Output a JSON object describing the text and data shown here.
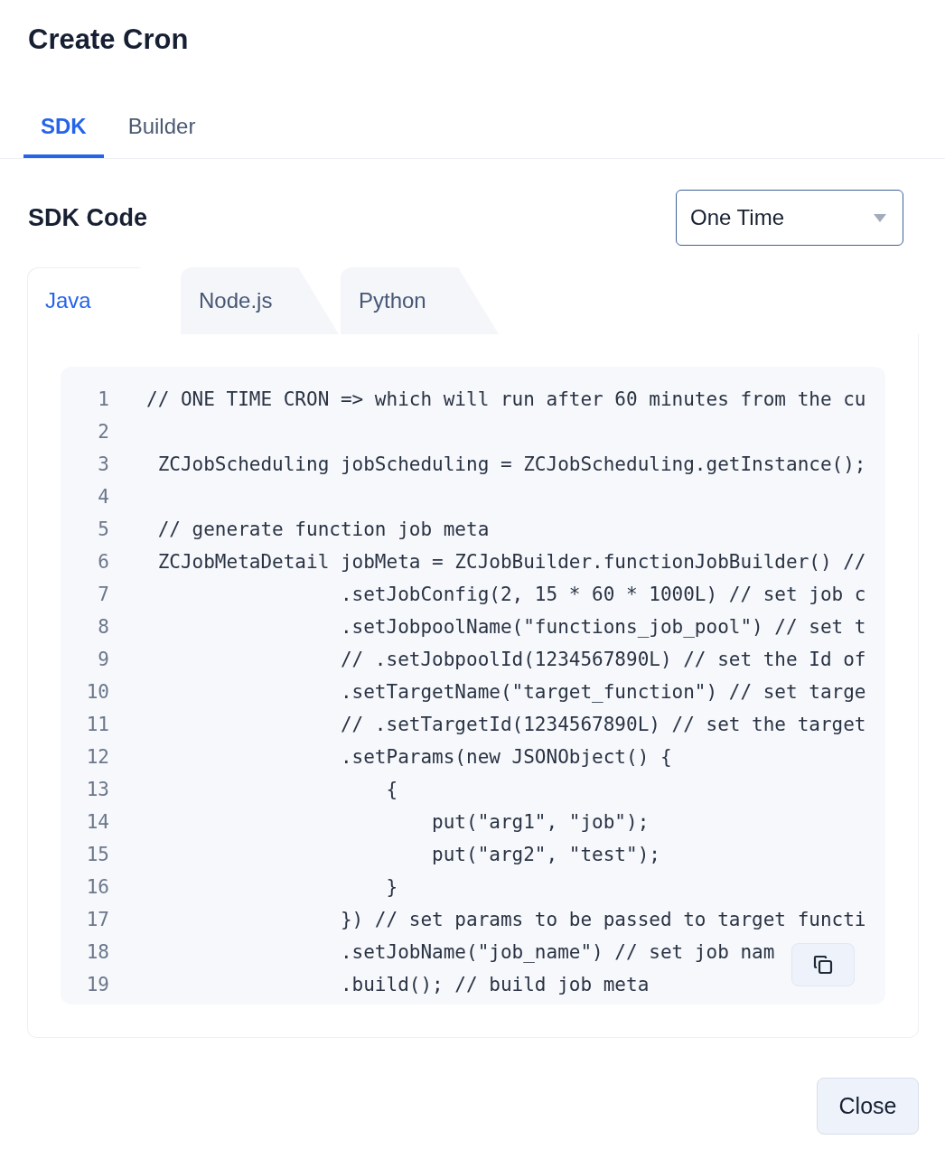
{
  "title": "Create Cron",
  "tabs": [
    {
      "label": "SDK",
      "selected": true
    },
    {
      "label": "Builder",
      "selected": false
    }
  ],
  "section_title": "SDK Code",
  "schedule_select": {
    "value": "One Time"
  },
  "language_tabs": [
    {
      "label": "Java",
      "selected": true
    },
    {
      "label": "Node.js",
      "selected": false
    },
    {
      "label": "Python",
      "selected": false
    }
  ],
  "code_lines": [
    {
      "number": "1",
      "text": "// ONE TIME CRON => which will run after 60 minutes from the cu"
    },
    {
      "number": "2"
    },
    {
      "number": "3",
      "text": " ZCJobScheduling jobScheduling = ZCJobScheduling.getInstance();"
    },
    {
      "number": "4"
    },
    {
      "number": "5",
      "text": " // generate function job meta"
    },
    {
      "number": "6",
      "text": " ZCJobMetaDetail jobMeta = ZCJobBuilder.functionJobBuilder() //"
    },
    {
      "number": "7",
      "text": "                 .setJobConfig(2, 15 * 60 * 1000L) // set job c"
    },
    {
      "number": "8",
      "text": "                 .setJobpoolName(\"functions_job_pool\") // set t"
    },
    {
      "number": "9",
      "text": "                 // .setJobpoolId(1234567890L) // set the Id of"
    },
    {
      "number": "10",
      "text": "                 .setTargetName(\"target_function\") // set targe"
    },
    {
      "number": "11",
      "text": "                 // .setTargetId(1234567890L) // set the target"
    },
    {
      "number": "12",
      "text": "                 .setParams(new JSONObject() {"
    },
    {
      "number": "13",
      "text": "                     {"
    },
    {
      "number": "14",
      "text": "                         put(\"arg1\", \"job\");"
    },
    {
      "number": "15",
      "text": "                         put(\"arg2\", \"test\");"
    },
    {
      "number": "16",
      "text": "                     }"
    },
    {
      "number": "17",
      "text": "                 }) // set params to be passed to target functi"
    },
    {
      "number": "18",
      "text": "                 .setJobName(\"job_name\") // set job nam"
    },
    {
      "number": "19",
      "text": "                 .build(); // build job meta"
    }
  ],
  "close_button": "Close"
}
